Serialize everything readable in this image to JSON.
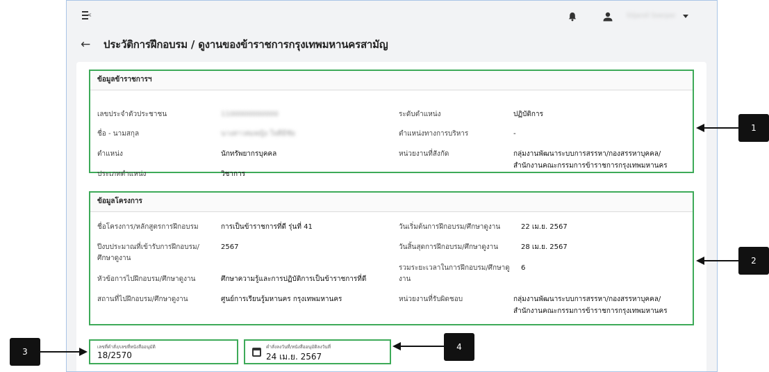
{
  "header": {
    "user_name": "Siljaroll Soerpen",
    "menu_icon": "menu-collapse-icon",
    "bell_icon": "bell-icon",
    "user_icon": "user-icon"
  },
  "page": {
    "title": "ประวัติการฝึกอบรม / ดูงานของข้าราชการกรุงเทพมหานครสามัญ"
  },
  "officer_section": {
    "title": "ข้อมูลข้าราชการฯ",
    "id_label": "เลขประจำตัวประชาชน",
    "id_value": "1100000000000",
    "name_label": "ชื่อ - นามสกุล",
    "name_value": "นางสาวสมหญิง ใจดีมีชัย",
    "position_label": "ตำแหน่ง",
    "position_value": "นักทรัพยากรบุคคล",
    "type_label": "ประเภทตำแหน่ง",
    "type_value": "วิชาการ",
    "level_label": "ระดับตำแหน่ง",
    "level_value": "ปฏิบัติการ",
    "admin_label": "ตำแหน่งทางการบริหาร",
    "admin_value": "-",
    "unit_label": "หน่วยงานที่สังกัด",
    "unit_value_line1": "กลุ่มงานพัฒนาระบบการสรรหา/กองสรรหาบุคคล/",
    "unit_value_line2": "สำนักงานคณะกรรมการข้าราชการกรุงเทพมหานคร"
  },
  "project_section": {
    "title": "ข้อมูลโครงการ",
    "project_label": "ชื่อโครงการ/หลักสูตรการฝึกอบรม",
    "project_value": "การเป็นข้าราชการที่ดี รุ่นที่ 41",
    "budget_label_line1": "ปีงบประมาณที่เข้ารับการฝึกอบรม/",
    "budget_label_line2": "ศึกษาดูงาน",
    "budget_value": "2567",
    "topic_label": "หัวข้อการไปฝึกอบรม/ศึกษาดูงาน",
    "topic_value": "ศึกษาความรู้และการปฏิบัติการเป็นข้าราชการที่ดี",
    "place_label": "สถานที่ไปฝึกอบรม/ศึกษาดูงาน",
    "place_value": "ศูนย์การเรียนรู้มหานคร กรุงเทพมหานคร",
    "start_label": "วันเริ่มต้นการฝึกอบรม/ศึกษาดูงาน",
    "start_value": "22 เม.ย. 2567",
    "end_label": "วันสิ้นสุดการฝึกอบรม/ศึกษาดูงาน",
    "end_value": "28 เม.ย. 2567",
    "duration_label_line1": "รวมระยะเวลาในการฝึกอบรม/ศึกษาดู",
    "duration_label_line2": "งาน",
    "duration_value": "6",
    "resp_label": "หน่วยงานที่รับผิดชอบ",
    "resp_value_line1": "กลุ่มงานพัฒนาระบบการสรรหา/กองสรรหาบุคคล/",
    "resp_value_line2": "สำนักงานคณะกรรมการข้าราชการกรุงเทพมหานคร"
  },
  "order_fields": {
    "order_no_label": "เลขที่คำสั่ง/เลขที่หนังสืออนุมัติ",
    "order_no_value": "18/2570",
    "order_date_label": "คำสั่งลงวันที่/หนังสืออนุมัติลงวันที่",
    "order_date_value": "24 เม.ย. 2567",
    "calendar_icon": "calendar-icon"
  },
  "callouts": [
    "1",
    "2",
    "3",
    "4"
  ],
  "colors": {
    "highlight": "#3daa58",
    "callout": "#111111",
    "frame_border": "#a9c5e6"
  }
}
